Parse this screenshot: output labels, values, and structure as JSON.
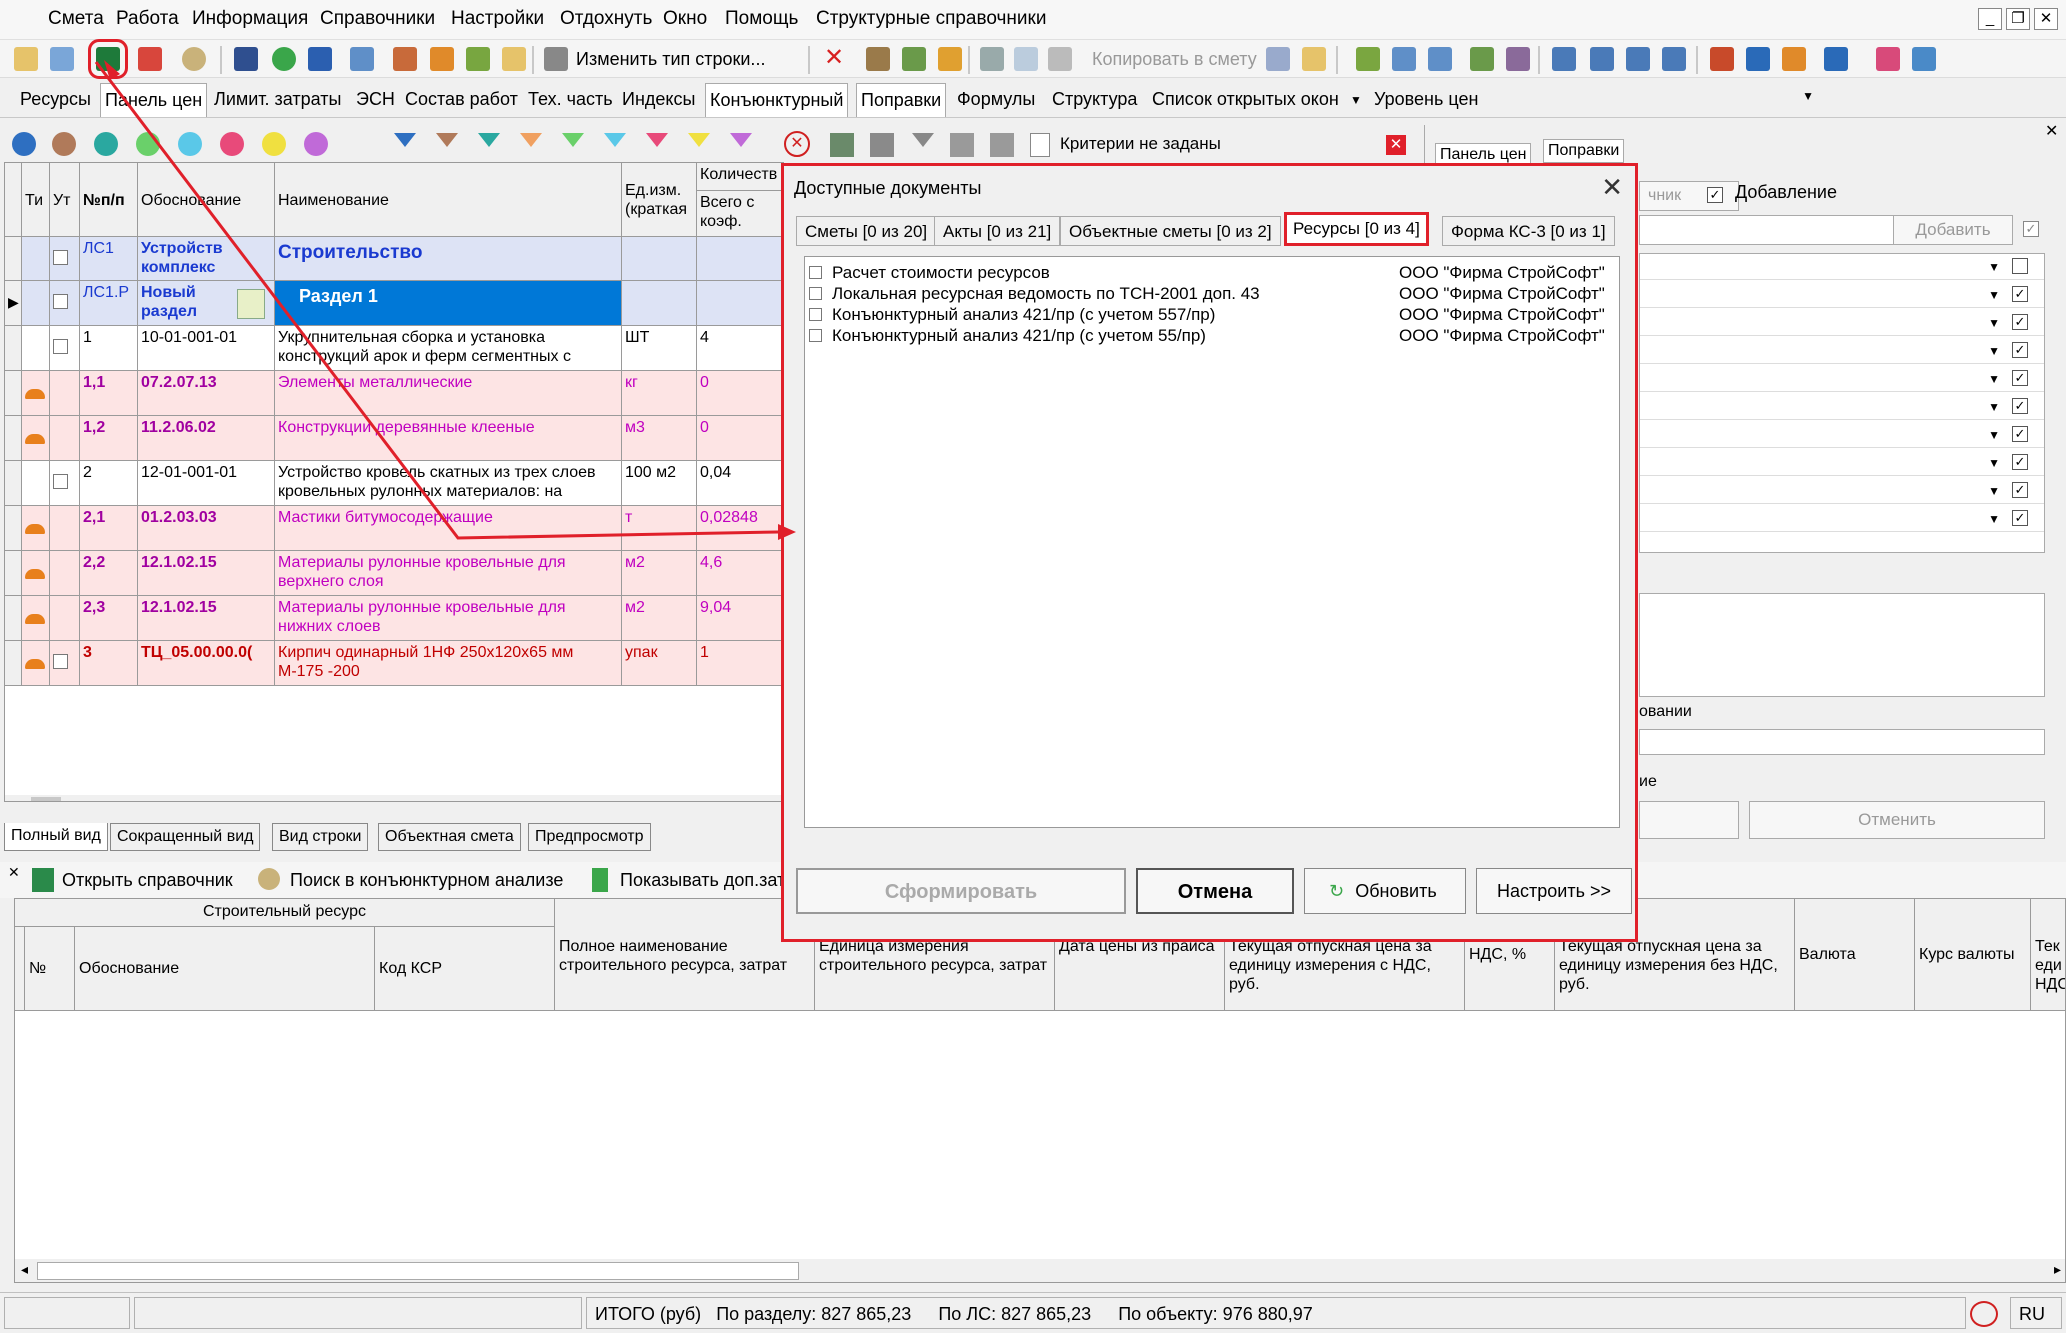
{
  "menu": [
    "Смета",
    "Работа",
    "Информация",
    "Справочники",
    "Настройки",
    "Отдохнуть",
    "Окно",
    "Помощь",
    "Структурные справочники"
  ],
  "toolbar": {
    "change_row_type": "Изменить тип строки...",
    "copy_to_estimate": "Копировать в смету"
  },
  "tabs": [
    "Ресурсы",
    "Панель цен",
    "Лимит. затраты",
    "ЭСН",
    "Состав работ",
    "Тех. часть",
    "Индексы",
    "Конъюнктурный",
    "Поправки",
    "Формулы",
    "Структура",
    "Список открытых окон",
    "Уровень цен"
  ],
  "filter": {
    "criteria": "Критерии не заданы"
  },
  "grid": {
    "headers": [
      "Ти",
      "Ут",
      "№п/п",
      "Обоснование",
      "Наименование",
      "Ед.изм. (краткая",
      "Количеств",
      "Всего с коэф."
    ],
    "rows": [
      {
        "num": "ЛС1",
        "code": "Устройств комплекс",
        "name": "Строительство",
        "unit": "",
        "qty": ""
      },
      {
        "num": "ЛС1.Р",
        "code": "Новый раздел",
        "name": "Раздел 1",
        "unit": "",
        "qty": ""
      },
      {
        "num": "1",
        "code": "10-01-001-01",
        "name": "Укрупнительная сборка и установка конструкций арок и ферм сегментных с",
        "unit": "ШТ",
        "qty": "4"
      },
      {
        "num": "1,1",
        "code": "07.2.07.13",
        "name": "Элементы металлические",
        "unit": "кг",
        "qty": "0"
      },
      {
        "num": "1,2",
        "code": "11.2.06.02",
        "name": "Конструкции деревянные клееные",
        "unit": "м3",
        "qty": "0"
      },
      {
        "num": "2",
        "code": "12-01-001-01",
        "name": "Устройство кровель скатных из трех слоев кровельных рулонных материалов: на",
        "unit": "100 м2",
        "qty": "0,04"
      },
      {
        "num": "2,1",
        "code": "01.2.03.03",
        "name": "Мастики битумосодержащие",
        "unit": "т",
        "qty": "0,02848"
      },
      {
        "num": "2,2",
        "code": "12.1.02.15",
        "name": "Материалы рулонные кровельные для верхнего слоя",
        "unit": "м2",
        "qty": "4,6"
      },
      {
        "num": "2,3",
        "code": "12.1.02.15",
        "name": "Материалы рулонные кровельные для нижних слоев",
        "unit": "м2",
        "qty": "9,04"
      },
      {
        "num": "3",
        "code": "ТЦ_05.00.00.0(",
        "name": "Кирпич одинарный 1НФ 250х120х65 мм М-175 -200",
        "unit": "упак",
        "qty": "1"
      }
    ]
  },
  "view_tabs": [
    "Полный вид",
    "Сокращенный вид",
    "Вид строки",
    "Объектная смета",
    "Предпросмотр"
  ],
  "lower": {
    "toolbar": [
      "Открыть справочник",
      "Поиск в конъюнктурном анализе",
      "Показывать доп.зат"
    ],
    "group_header": "Строительный ресурс",
    "headers": [
      "№",
      "Обоснование",
      "Код КСР",
      "Полное наименование строительного ресурса, затрат",
      "Единица измерения строительного ресурса, затрат",
      "Дата цены из прайса",
      "Текущая отпускная цена за единицу измерения с НДС, руб.",
      "НДС, %",
      "Текущая отпускная цена за единицу измерения без НДС, руб.",
      "Валюта",
      "Курс валюты",
      "Тек еди НДС"
    ]
  },
  "right_panel": {
    "tabs": [
      "Панель цен",
      "Поправки"
    ],
    "btn_left": "чник",
    "add_check_label": "Добавление",
    "add_btn": "Добавить",
    "partial_label1": "овании",
    "partial_label2": "ие",
    "cancel_btn": "Отменить"
  },
  "dialog": {
    "title": "Доступные документы",
    "tabs": [
      "Сметы [0 из 20]",
      "Акты [0 из 21]",
      "Объектные сметы [0 из 2]",
      "Ресурсы [0 из 4]",
      "Форма КС-3 [0 из 1]"
    ],
    "items": [
      {
        "name": "Расчет стоимости ресурсов",
        "org": "ООО \"Фирма СтройСофт\""
      },
      {
        "name": "Локальная ресурсная ведомость по ТСН-2001 доп. 43",
        "org": "ООО \"Фирма СтройСофт\""
      },
      {
        "name": "Конъюнктурный анализ 421/пр (с учетом 557/пр)",
        "org": "ООО \"Фирма СтройСофт\""
      },
      {
        "name": "Конъюнктурный анализ 421/пр (с учетом 55/пр)",
        "org": "ООО \"Фирма СтройСофт\""
      }
    ],
    "buttons": {
      "form": "Сформировать",
      "cancel": "Отмена",
      "refresh": "Обновить",
      "configure": "Настроить >>"
    }
  },
  "status": {
    "total": "ИТОГО (руб)",
    "by_section": "По разделу: 827 865,23",
    "by_ls": "По ЛС: 827 865,23",
    "by_object": "По объекту: 976 880,97",
    "lang": "RU"
  },
  "colors": {
    "accent_red": "#e0202a",
    "section_blue": "#0078d7",
    "resource_pink": "#fde4e4",
    "resource_text": "#c000c0"
  }
}
